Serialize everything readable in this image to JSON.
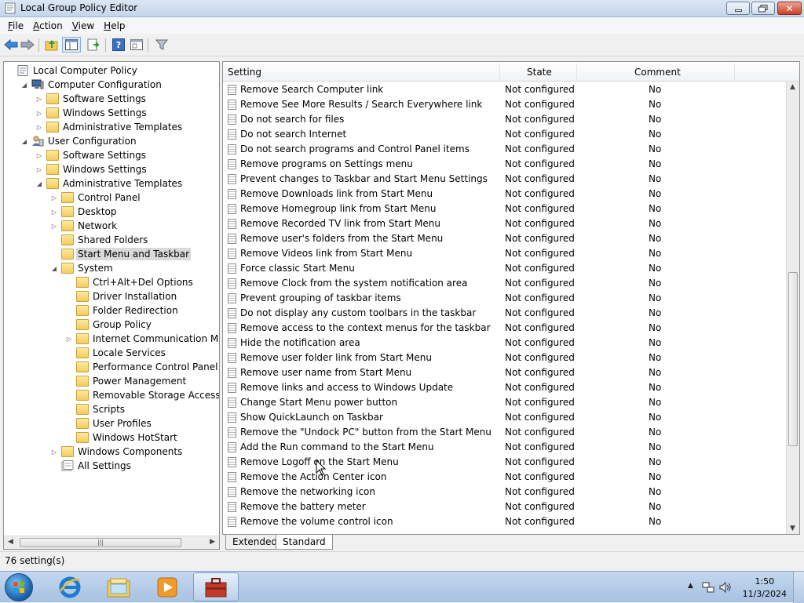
{
  "window": {
    "title": "Local Group Policy Editor"
  },
  "menu": [
    {
      "first": "F",
      "rest": "ile"
    },
    {
      "first": "A",
      "rest": "ction"
    },
    {
      "first": "V",
      "rest": "iew"
    },
    {
      "first": "H",
      "rest": "elp"
    }
  ],
  "toolbar": {
    "icons": [
      "back-arrow-icon",
      "forward-arrow-icon",
      "up-folder-icon",
      "show-hide-tree-icon",
      "export-list-icon",
      "help-icon",
      "properties-icon",
      "filter-icon"
    ]
  },
  "tree": [
    {
      "label": "Local Computer Policy",
      "level": 0,
      "arrow": "",
      "icon": "policy-icon"
    },
    {
      "label": "Computer Configuration",
      "level": 1,
      "arrow": "◢",
      "icon": "computer-icon"
    },
    {
      "label": "Software Settings",
      "level": 2,
      "arrow": "▷",
      "icon": "folder-icon"
    },
    {
      "label": "Windows Settings",
      "level": 2,
      "arrow": "▷",
      "icon": "folder-icon"
    },
    {
      "label": "Administrative Templates",
      "level": 2,
      "arrow": "▷",
      "icon": "folder-icon"
    },
    {
      "label": "User Configuration",
      "level": 1,
      "arrow": "◢",
      "icon": "user-icon"
    },
    {
      "label": "Software Settings",
      "level": 2,
      "arrow": "▷",
      "icon": "folder-icon"
    },
    {
      "label": "Windows Settings",
      "level": 2,
      "arrow": "▷",
      "icon": "folder-icon"
    },
    {
      "label": "Administrative Templates",
      "level": 2,
      "arrow": "◢",
      "icon": "folder-icon"
    },
    {
      "label": "Control Panel",
      "level": 3,
      "arrow": "▷",
      "icon": "folder-icon"
    },
    {
      "label": "Desktop",
      "level": 3,
      "arrow": "▷",
      "icon": "folder-icon"
    },
    {
      "label": "Network",
      "level": 3,
      "arrow": "▷",
      "icon": "folder-icon"
    },
    {
      "label": "Shared Folders",
      "level": 3,
      "arrow": "",
      "icon": "folder-icon"
    },
    {
      "label": "Start Menu and Taskbar",
      "level": 3,
      "arrow": "",
      "icon": "folder-icon",
      "selected": true
    },
    {
      "label": "System",
      "level": 3,
      "arrow": "◢",
      "icon": "folder-icon"
    },
    {
      "label": "Ctrl+Alt+Del Options",
      "level": 4,
      "arrow": "",
      "icon": "folder-icon"
    },
    {
      "label": "Driver Installation",
      "level": 4,
      "arrow": "",
      "icon": "folder-icon"
    },
    {
      "label": "Folder Redirection",
      "level": 4,
      "arrow": "",
      "icon": "folder-icon"
    },
    {
      "label": "Group Policy",
      "level": 4,
      "arrow": "",
      "icon": "folder-icon"
    },
    {
      "label": "Internet Communication Manag",
      "level": 4,
      "arrow": "▷",
      "icon": "folder-icon"
    },
    {
      "label": "Locale Services",
      "level": 4,
      "arrow": "",
      "icon": "folder-icon"
    },
    {
      "label": "Performance Control Panel",
      "level": 4,
      "arrow": "",
      "icon": "folder-icon"
    },
    {
      "label": "Power Management",
      "level": 4,
      "arrow": "",
      "icon": "folder-icon"
    },
    {
      "label": "Removable Storage Access",
      "level": 4,
      "arrow": "",
      "icon": "folder-icon"
    },
    {
      "label": "Scripts",
      "level": 4,
      "arrow": "",
      "icon": "folder-icon"
    },
    {
      "label": "User Profiles",
      "level": 4,
      "arrow": "",
      "icon": "folder-icon"
    },
    {
      "label": "Windows HotStart",
      "level": 4,
      "arrow": "",
      "icon": "folder-icon"
    },
    {
      "label": "Windows Components",
      "level": 3,
      "arrow": "▷",
      "icon": "folder-icon"
    },
    {
      "label": "All Settings",
      "level": 3,
      "arrow": "",
      "icon": "all-settings-icon"
    }
  ],
  "list": {
    "columns": {
      "setting": "Setting",
      "state": "State",
      "comment": "Comment"
    },
    "rows": [
      {
        "setting": "Remove Search Computer link",
        "state": "Not configured",
        "comment": "No"
      },
      {
        "setting": "Remove See More Results / Search Everywhere link",
        "state": "Not configured",
        "comment": "No"
      },
      {
        "setting": "Do not search for files",
        "state": "Not configured",
        "comment": "No"
      },
      {
        "setting": "Do not search Internet",
        "state": "Not configured",
        "comment": "No"
      },
      {
        "setting": "Do not search programs and Control Panel items",
        "state": "Not configured",
        "comment": "No"
      },
      {
        "setting": "Remove programs on Settings menu",
        "state": "Not configured",
        "comment": "No"
      },
      {
        "setting": "Prevent changes to Taskbar and Start Menu Settings",
        "state": "Not configured",
        "comment": "No"
      },
      {
        "setting": "Remove Downloads link from Start Menu",
        "state": "Not configured",
        "comment": "No"
      },
      {
        "setting": "Remove Homegroup link from Start Menu",
        "state": "Not configured",
        "comment": "No"
      },
      {
        "setting": "Remove Recorded TV link from Start Menu",
        "state": "Not configured",
        "comment": "No"
      },
      {
        "setting": "Remove user's folders from the Start Menu",
        "state": "Not configured",
        "comment": "No"
      },
      {
        "setting": "Remove Videos link from Start Menu",
        "state": "Not configured",
        "comment": "No"
      },
      {
        "setting": "Force classic Start Menu",
        "state": "Not configured",
        "comment": "No"
      },
      {
        "setting": "Remove Clock from the system notification area",
        "state": "Not configured",
        "comment": "No"
      },
      {
        "setting": "Prevent grouping of taskbar items",
        "state": "Not configured",
        "comment": "No"
      },
      {
        "setting": "Do not display any custom toolbars in the taskbar",
        "state": "Not configured",
        "comment": "No"
      },
      {
        "setting": "Remove access to the context menus for the taskbar",
        "state": "Not configured",
        "comment": "No"
      },
      {
        "setting": "Hide the notification area",
        "state": "Not configured",
        "comment": "No"
      },
      {
        "setting": "Remove user folder link from Start Menu",
        "state": "Not configured",
        "comment": "No"
      },
      {
        "setting": "Remove user name from Start Menu",
        "state": "Not configured",
        "comment": "No"
      },
      {
        "setting": "Remove links and access to Windows Update",
        "state": "Not configured",
        "comment": "No"
      },
      {
        "setting": "Change Start Menu power button",
        "state": "Not configured",
        "comment": "No"
      },
      {
        "setting": "Show QuickLaunch on Taskbar",
        "state": "Not configured",
        "comment": "No"
      },
      {
        "setting": "Remove the \"Undock PC\" button from the Start Menu",
        "state": "Not configured",
        "comment": "No"
      },
      {
        "setting": "Add the Run command to the Start Menu",
        "state": "Not configured",
        "comment": "No"
      },
      {
        "setting": "Remove Logoff on the Start Menu",
        "state": "Not configured",
        "comment": "No"
      },
      {
        "setting": "Remove the Action Center icon",
        "state": "Not configured",
        "comment": "No"
      },
      {
        "setting": "Remove the networking icon",
        "state": "Not configured",
        "comment": "No"
      },
      {
        "setting": "Remove the battery meter",
        "state": "Not configured",
        "comment": "No"
      },
      {
        "setting": "Remove the volume control icon",
        "state": "Not configured",
        "comment": "No"
      }
    ]
  },
  "tabs": [
    "Extended",
    "Standard"
  ],
  "status": {
    "text": "76 setting(s)"
  },
  "taskbar": {
    "apps": [
      "internet-explorer-icon",
      "windows-explorer-icon",
      "media-player-icon",
      "group-policy-editor-icon"
    ],
    "clock_time": "1:50",
    "clock_date": "11/3/2024"
  }
}
